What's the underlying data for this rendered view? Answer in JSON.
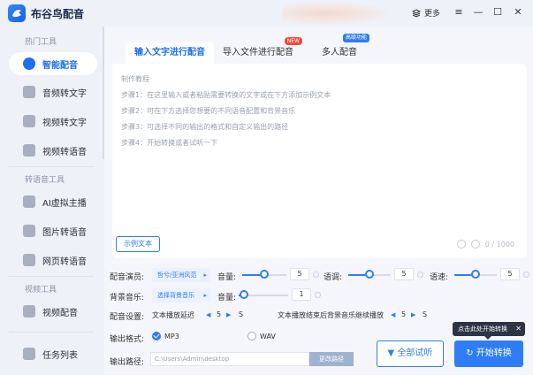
{
  "app": {
    "title": "布谷鸟配音",
    "more_label": "更多",
    "window_controls": {
      "menu": "≡",
      "minimize": "—",
      "maximize": "☐",
      "close": "✕"
    }
  },
  "sidebar": {
    "section_hot": "热门工具",
    "section_convert": "转语音工具",
    "section_video": "视频工具",
    "items": [
      {
        "label": "智能配音",
        "icon": "smart-dub-icon",
        "active": true
      },
      {
        "label": "音频转文字",
        "icon": "audio-to-text-icon"
      },
      {
        "label": "视频转文字",
        "icon": "video-to-text-icon"
      },
      {
        "label": "视频转语音",
        "icon": "video-to-voice-icon"
      },
      {
        "label": "AI虚拟主播",
        "icon": "ai-anchor-icon"
      },
      {
        "label": "图片转语音",
        "icon": "image-to-voice-icon"
      },
      {
        "label": "网页转语音",
        "icon": "web-to-voice-icon"
      },
      {
        "label": "视频配音",
        "icon": "video-dub-icon"
      },
      {
        "label": "任务列表",
        "icon": "task-list-icon"
      }
    ]
  },
  "tabs": [
    {
      "label": "输入文字进行配音",
      "active": true
    },
    {
      "label": "导入文件进行配音",
      "badge": "NEW"
    },
    {
      "label": "多人配音",
      "badge": "高级功能"
    }
  ],
  "editor": {
    "lines": [
      "制作教程",
      "步骤1：在这里输入或者粘贴需要转换的文字或在下方添加示例文本",
      "步骤2：可在下方选择您想要的不同语音配置和背景音乐",
      "步骤3：可选择不同的输出的格式和自定义输出的路径",
      "步骤4：开始转换或者试听一下"
    ],
    "sample_button": "示例文本",
    "char_count": "0 / 1000"
  },
  "settings": {
    "voice_label": "配音演员:",
    "voice_value": "哲兮/亚洲风范",
    "volume_label": "音量:",
    "volume_value": "5",
    "pitch_label": "语调:",
    "pitch_value": "5",
    "speed_label": "语速:",
    "speed_value": "5",
    "bgm_label": "背景音乐:",
    "bgm_value": "选择背景音乐",
    "bgm_volume_label": "音量:",
    "bgm_volume_value": "1",
    "config_label": "配音设置:",
    "delay_label": "文本播放延迟",
    "delay_value": "5",
    "delay_unit": "S",
    "after_label": "文本播放结束后背景音乐继续播放",
    "after_value": "5",
    "after_unit": "S",
    "format_label": "输出格式:",
    "format_mp3": "MP3",
    "format_wav": "WAV",
    "path_label": "输出路径:",
    "path_value": "C:\\Users\\Admin\\desktop",
    "path_button": "更改路径"
  },
  "actions": {
    "listen": "全部试听",
    "start": "开始转换",
    "tooltip": "点击此处开始转换"
  },
  "levels": {
    "volume": 0.5,
    "pitch": 0.5,
    "speed": 0.5,
    "bgm_volume": 0.1
  },
  "colors": {
    "accent": "#2f7df6",
    "sidebar_bg": "#eef1f8",
    "tag_new": "#f04a3c"
  }
}
